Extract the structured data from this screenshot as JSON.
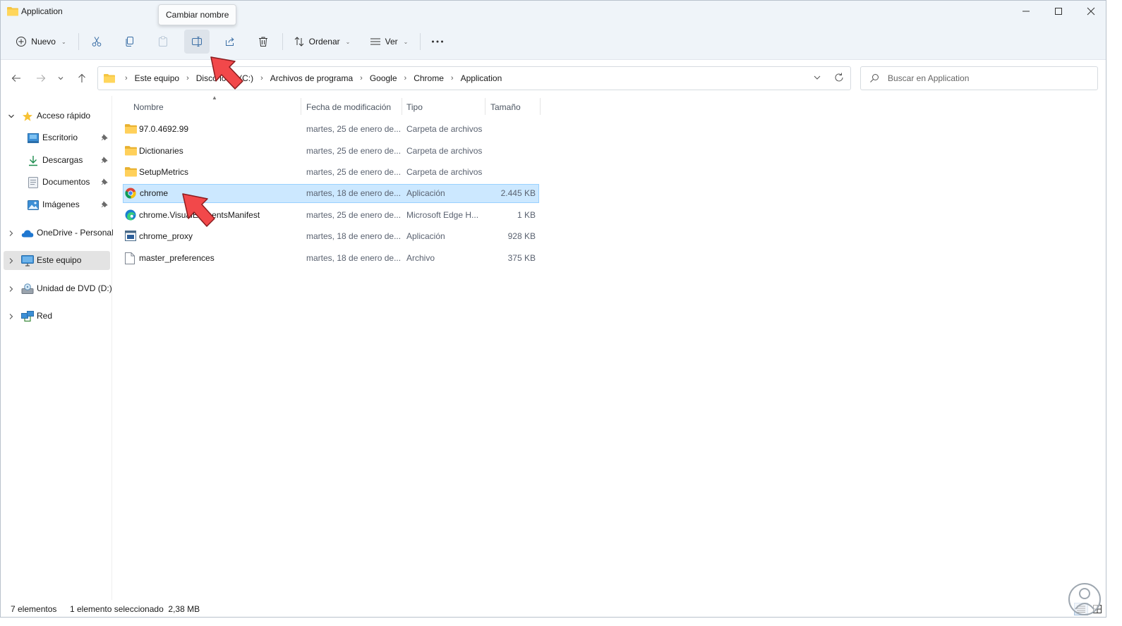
{
  "window": {
    "title": "Application"
  },
  "tooltip": "Cambiar nombre",
  "toolbar": {
    "new_label": "Nuevo",
    "sort_label": "Ordenar",
    "view_label": "Ver",
    "icons": [
      "add-icon",
      "cut-icon",
      "copy-icon",
      "paste-icon",
      "rename-icon",
      "share-icon",
      "delete-icon",
      "sort-icon",
      "view-icon",
      "more-icon"
    ]
  },
  "address": {
    "crumbs": [
      "Este equipo",
      "Disco local (C:)",
      "Archivos de programa",
      "Google",
      "Chrome",
      "Application"
    ]
  },
  "search": {
    "placeholder": "Buscar en Application"
  },
  "sidebar": {
    "quick_access": "Acceso rápido",
    "items": [
      "Escritorio",
      "Descargas",
      "Documentos",
      "Imágenes"
    ],
    "onedrive": "OneDrive - Personal",
    "this_pc": "Este equipo",
    "dvd": "Unidad de DVD (D:)",
    "network": "Red"
  },
  "columns": {
    "name": "Nombre",
    "date": "Fecha de modificación",
    "type": "Tipo",
    "size": "Tamaño"
  },
  "files": [
    {
      "name": "97.0.4692.99",
      "date": "martes, 25 de enero de...",
      "type": "Carpeta de archivos",
      "size": "",
      "icon": "folder-icon"
    },
    {
      "name": "Dictionaries",
      "date": "martes, 25 de enero de...",
      "type": "Carpeta de archivos",
      "size": "",
      "icon": "folder-icon"
    },
    {
      "name": "SetupMetrics",
      "date": "martes, 25 de enero de...",
      "type": "Carpeta de archivos",
      "size": "",
      "icon": "folder-icon"
    },
    {
      "name": "chrome",
      "date": "martes, 18 de enero de...",
      "type": "Aplicación",
      "size": "2.445 KB",
      "icon": "chrome-icon",
      "selected": true
    },
    {
      "name": "chrome.VisualElementsManifest",
      "date": "martes, 25 de enero de...",
      "type": "Microsoft Edge H...",
      "size": "1 KB",
      "icon": "edge-icon"
    },
    {
      "name": "chrome_proxy",
      "date": "martes, 18 de enero de...",
      "type": "Aplicación",
      "size": "928 KB",
      "icon": "app-icon"
    },
    {
      "name": "master_preferences",
      "date": "martes, 18 de enero de...",
      "type": "Archivo",
      "size": "375 KB",
      "icon": "file-icon"
    }
  ],
  "status": {
    "count": "7 elementos",
    "selection": "1 elemento seleccionado  2,38 MB"
  },
  "colors": {
    "accent": "#0067c0",
    "selection": "#cce8ff",
    "chrome_bg": "#eff4f9",
    "pointer": "#f2484a"
  }
}
